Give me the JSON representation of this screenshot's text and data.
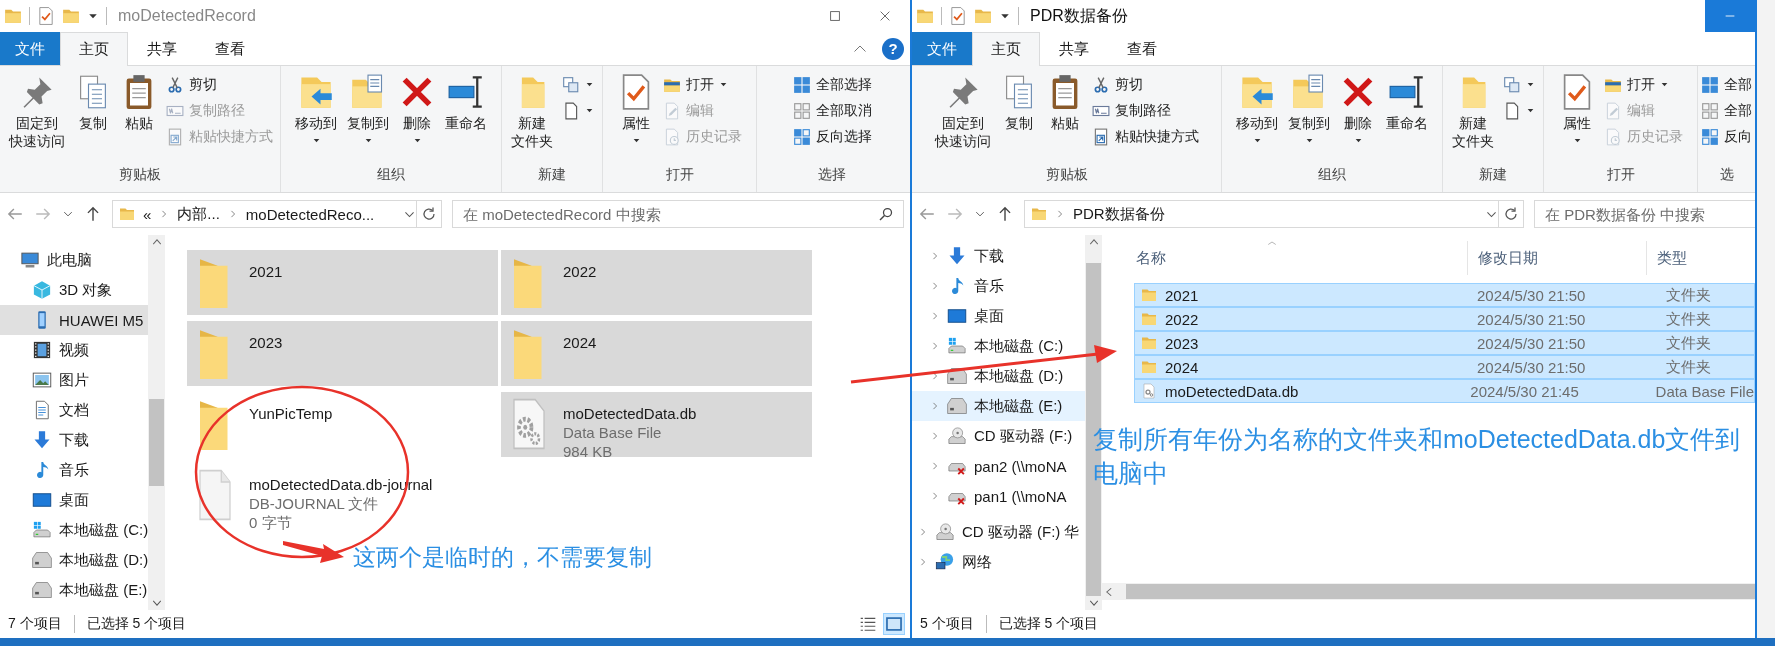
{
  "windows": [
    {
      "title": "moDetectedRecord",
      "active": false,
      "help": "?",
      "caption_buttons": [
        {
          "kind": "maximize",
          "hover": false
        },
        {
          "kind": "close",
          "hover": false
        }
      ],
      "tabs": [
        {
          "label": "文件",
          "kind": "file",
          "selected": false
        },
        {
          "label": "主页",
          "kind": "tab",
          "selected": true
        },
        {
          "label": "共享",
          "kind": "tab",
          "selected": false
        },
        {
          "label": "查看",
          "kind": "tab",
          "selected": false
        }
      ],
      "ribbon": [
        {
          "label": "剪贴板",
          "items": [
            {
              "kind": "pin",
              "lines": [
                "固定到",
                "快速访问"
              ],
              "dropdown": false,
              "disabled": false
            },
            {
              "kind": "copy",
              "label": "复制",
              "dropdown": false,
              "disabled": false
            },
            {
              "kind": "paste",
              "label": "粘贴",
              "dropdown": false,
              "disabled": false
            },
            {
              "stack": [
                {
                  "kind": "cut",
                  "label": "剪切",
                  "dropdown": false,
                  "disabled": false
                },
                {
                  "kind": "copypath",
                  "label": "复制路径",
                  "dropdown": false,
                  "disabled": true
                },
                {
                  "kind": "pasteshortcut",
                  "label": "粘贴快捷方式",
                  "dropdown": false,
                  "disabled": true
                }
              ]
            }
          ]
        },
        {
          "label": "组织",
          "items": [
            {
              "kind": "moveto",
              "label": "移动到",
              "dropdown": true,
              "disabled": false
            },
            {
              "kind": "copyto",
              "label": "复制到",
              "dropdown": true,
              "disabled": false
            },
            {
              "kind": "delete",
              "label": "删除",
              "dropdown": true,
              "disabled": false
            },
            {
              "kind": "rename",
              "label": "重命名",
              "dropdown": false,
              "disabled": false
            }
          ]
        },
        {
          "label": "新建",
          "items": [
            {
              "kind": "newfolder",
              "lines": [
                "新建",
                "文件夹"
              ],
              "dropdown": false,
              "disabled": false
            },
            {
              "stack": [
                {
                  "kind": "newitem",
                  "dropdown": true,
                  "disabled": false
                },
                {
                  "kind": "easyaccess",
                  "dropdown": true,
                  "disabled": false
                }
              ]
            }
          ]
        },
        {
          "label": "打开",
          "items": [
            {
              "kind": "properties",
              "label": "属性",
              "dropdown": true,
              "disabled": false
            },
            {
              "stack": [
                {
                  "kind": "open",
                  "label": "打开",
                  "dropdown": true,
                  "disabled": false
                },
                {
                  "kind": "edit",
                  "label": "编辑",
                  "dropdown": false,
                  "disabled": true
                },
                {
                  "kind": "history",
                  "label": "历史记录",
                  "dropdown": false,
                  "disabled": true
                }
              ]
            }
          ]
        },
        {
          "label": "选择",
          "items": [
            {
              "stack": [
                {
                  "kind": "selectall",
                  "label": "全部选择",
                  "dropdown": false,
                  "disabled": false
                },
                {
                  "kind": "selectnone",
                  "label": "全部取消",
                  "dropdown": false,
                  "disabled": false
                },
                {
                  "kind": "invert",
                  "label": "反向选择",
                  "dropdown": false,
                  "disabled": false
                }
              ]
            }
          ]
        }
      ],
      "address": {
        "overflow": "«",
        "path": [
          "内部...",
          "moDetectedReco..."
        ]
      },
      "search": {
        "placeholder": "在 moDetectedRecord 中搜索"
      },
      "nav": [
        {
          "label": "此电脑",
          "kind": "computer",
          "selected": false,
          "children": [
            {
              "label": "3D 对象",
              "kind": "cube",
              "selected": false
            },
            {
              "label": "HUAWEI M5",
              "kind": "phone",
              "selected": true
            },
            {
              "label": "视频",
              "kind": "videos",
              "selected": false
            },
            {
              "label": "图片",
              "kind": "pictures",
              "selected": false
            },
            {
              "label": "文档",
              "kind": "documents",
              "selected": false
            },
            {
              "label": "下载",
              "kind": "downloads",
              "selected": false
            },
            {
              "label": "音乐",
              "kind": "music",
              "selected": false
            },
            {
              "label": "桌面",
              "kind": "desktop",
              "selected": false
            },
            {
              "label": "本地磁盘 (C:)",
              "kind": "sysdrive",
              "selected": false
            },
            {
              "label": "本地磁盘 (D:)",
              "kind": "drive",
              "selected": false
            },
            {
              "label": "本地磁盘 (E:)",
              "kind": "drive",
              "selected": false
            }
          ]
        }
      ],
      "files": [
        {
          "name": "2021",
          "kind": "folder",
          "selected": true
        },
        {
          "name": "2022",
          "kind": "folder",
          "selected": true
        },
        {
          "name": "2023",
          "kind": "folder",
          "selected": true
        },
        {
          "name": "2024",
          "kind": "folder",
          "selected": true
        },
        {
          "name": "YunPicTemp",
          "kind": "folder",
          "selected": false
        },
        {
          "name": "moDetectedData.db",
          "kind": "database",
          "selected": true,
          "details": [
            "Data Base File",
            "984 KB"
          ]
        },
        {
          "name": "moDetectedData.db-journal",
          "kind": "file",
          "selected": false,
          "details": [
            "DB-JOURNAL 文件",
            "0 字节"
          ]
        }
      ],
      "status": {
        "items": "7 个项目",
        "selection": "已选择 5 个项目",
        "view_buttons": [
          {
            "kind": "details",
            "selected": false
          },
          {
            "kind": "tiles",
            "selected": true
          }
        ]
      }
    },
    {
      "title": "PDR数据备份",
      "active": true,
      "caption_buttons": [
        {
          "kind": "minimize",
          "hover": true
        }
      ],
      "tabs": [
        {
          "label": "文件",
          "kind": "file",
          "selected": false
        },
        {
          "label": "主页",
          "kind": "tab",
          "selected": true
        },
        {
          "label": "共享",
          "kind": "tab",
          "selected": false
        },
        {
          "label": "查看",
          "kind": "tab",
          "selected": false
        }
      ],
      "ribbon": [
        {
          "label": "剪贴板",
          "items": [
            {
              "kind": "pin",
              "lines": [
                "固定到",
                "快速访问"
              ],
              "dropdown": false,
              "disabled": false
            },
            {
              "kind": "copy",
              "label": "复制",
              "dropdown": false,
              "disabled": false
            },
            {
              "kind": "paste",
              "label": "粘贴",
              "dropdown": false,
              "disabled": false
            },
            {
              "stack": [
                {
                  "kind": "cut",
                  "label": "剪切",
                  "dropdown": false,
                  "disabled": false
                },
                {
                  "kind": "copypath",
                  "label": "复制路径",
                  "dropdown": false,
                  "disabled": false
                },
                {
                  "kind": "pasteshortcut",
                  "label": "粘贴快捷方式",
                  "dropdown": false,
                  "disabled": false
                }
              ]
            }
          ]
        },
        {
          "label": "组织",
          "items": [
            {
              "kind": "moveto",
              "label": "移动到",
              "dropdown": true,
              "disabled": false
            },
            {
              "kind": "copyto",
              "label": "复制到",
              "dropdown": true,
              "disabled": false
            },
            {
              "kind": "delete",
              "label": "删除",
              "dropdown": true,
              "disabled": false
            },
            {
              "kind": "rename",
              "label": "重命名",
              "dropdown": false,
              "disabled": false
            }
          ]
        },
        {
          "label": "新建",
          "items": [
            {
              "kind": "newfolder",
              "lines": [
                "新建",
                "文件夹"
              ],
              "dropdown": false,
              "disabled": false
            },
            {
              "stack": [
                {
                  "kind": "newitem",
                  "dropdown": true,
                  "disabled": false
                },
                {
                  "kind": "easyaccess",
                  "dropdown": true,
                  "disabled": false
                }
              ]
            }
          ]
        },
        {
          "label": "打开",
          "items": [
            {
              "kind": "properties",
              "label": "属性",
              "dropdown": true,
              "disabled": false
            },
            {
              "stack": [
                {
                  "kind": "open",
                  "label": "打开",
                  "dropdown": true,
                  "disabled": false
                },
                {
                  "kind": "edit",
                  "label": "编辑",
                  "dropdown": false,
                  "disabled": true
                },
                {
                  "kind": "history",
                  "label": "历史记录",
                  "dropdown": false,
                  "disabled": true
                }
              ]
            }
          ]
        },
        {
          "label": "选",
          "items": [
            {
              "stack": [
                {
                  "kind": "selectall",
                  "label": "全部",
                  "dropdown": false,
                  "disabled": false
                },
                {
                  "kind": "selectnone",
                  "label": "全部",
                  "dropdown": false,
                  "disabled": false
                },
                {
                  "kind": "invert",
                  "label": "反向",
                  "dropdown": false,
                  "disabled": false
                }
              ]
            }
          ]
        }
      ],
      "address": {
        "path": [
          "PDR数据备份"
        ]
      },
      "search": {
        "placeholder": "在 PDR数据备份 中搜索"
      },
      "nav": [
        {
          "children": [
            {
              "label": "下载",
              "kind": "downloads",
              "selected": false,
              "expandable": true
            },
            {
              "label": "音乐",
              "kind": "music",
              "selected": false,
              "expandable": true
            },
            {
              "label": "桌面",
              "kind": "desktop",
              "selected": false,
              "expandable": true
            },
            {
              "label": "本地磁盘 (C:)",
              "kind": "sysdrive",
              "selected": false,
              "expandable": true
            },
            {
              "label": "本地磁盘 (D:)",
              "kind": "drive",
              "selected": false,
              "expandable": true
            },
            {
              "label": "本地磁盘 (E:)",
              "kind": "drive",
              "selected": true,
              "expandable": true
            },
            {
              "label": "CD 驱动器 (F:)",
              "kind": "optical",
              "selected": false,
              "expandable": true
            },
            {
              "label": "pan2 (\\\\moNA",
              "kind": "netdrive",
              "selected": false,
              "expandable": true
            },
            {
              "label": "pan1 (\\\\moNA",
              "kind": "netdrive",
              "selected": false,
              "expandable": true
            }
          ]
        },
        {
          "label": "CD 驱动器 (F:) 华",
          "kind": "optical",
          "selected": false,
          "expandable": true
        },
        {
          "label": "网络",
          "kind": "network",
          "selected": false,
          "expandable": true
        }
      ],
      "columns": [
        {
          "label": "名称",
          "sorted": true
        },
        {
          "label": "修改日期",
          "sorted": false
        },
        {
          "label": "类型",
          "sorted": false
        }
      ],
      "rows": [
        {
          "name": "2021",
          "date": "2024/5/30 21:50",
          "type": "文件夹",
          "kind": "folder",
          "selected": true
        },
        {
          "name": "2022",
          "date": "2024/5/30 21:50",
          "type": "文件夹",
          "kind": "folder",
          "selected": true
        },
        {
          "name": "2023",
          "date": "2024/5/30 21:50",
          "type": "文件夹",
          "kind": "folder",
          "selected": true
        },
        {
          "name": "2024",
          "date": "2024/5/30 21:50",
          "type": "文件夹",
          "kind": "folder",
          "selected": true
        },
        {
          "name": "moDetectedData.db",
          "date": "2024/5/30 21:45",
          "type": "Data Base File",
          "kind": "database",
          "selected": true
        }
      ],
      "status": {
        "items": "5 个项目",
        "selection": "已选择 5 个项目"
      }
    }
  ],
  "annotations": [
    {
      "kind": "ellipse"
    },
    {
      "kind": "arrow"
    },
    {
      "kind": "note",
      "text": "这两个是临时的，不需要复制"
    },
    {
      "kind": "arrow"
    },
    {
      "kind": "note",
      "text": "复制所有年份为名称的文件夹和moDetectedData.db文件到电脑中"
    }
  ]
}
